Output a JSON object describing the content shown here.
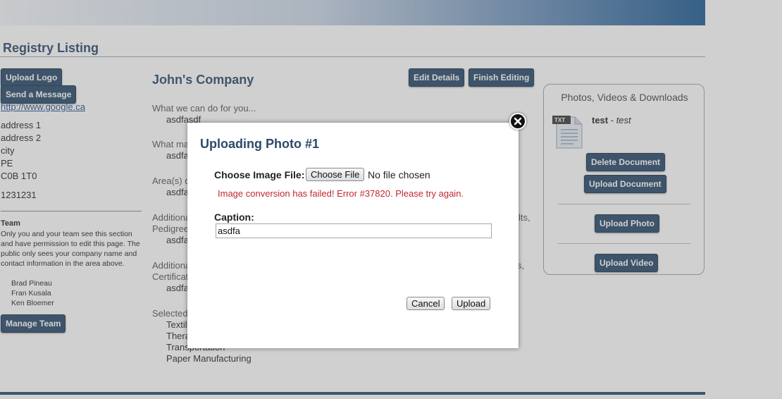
{
  "page": {
    "heading": "Registry Listing"
  },
  "left": {
    "upload_logo": "Upload Logo",
    "send_message": "Send a Message",
    "website": "http://www.google.ca",
    "address": [
      "address 1",
      "address 2",
      "city",
      "PE",
      "C0B 1T0"
    ],
    "phone": "1231231",
    "team_title": "Team",
    "team_desc": "Only you and your team see this section and have permission to edit this page. The public only sees your company name and contact information in the area above.",
    "members": [
      "Brad Pineau",
      "Fran Kusala",
      "Ken Bloemer"
    ],
    "manage_team": "Manage Team"
  },
  "main": {
    "company": "John's Company",
    "edit_details": "Edit Details",
    "finish_editing": "Finish Editing",
    "q1_label": "What we can do for you...",
    "q1_answer": "asdfasdf",
    "q2_label": "What ma",
    "q2_answer": "asdfa",
    "q3_label": "Area(s) o",
    "q3_answer": "asdfa",
    "q4_label": "Additiona",
    "q4_tail": "lts,",
    "q4_label2": "Pedigree",
    "q4_answer": "asdfa",
    "q5_label": "Additiona",
    "q5_tail": "s,",
    "q5_label2": "Certificat",
    "q5_answer": "asdfa",
    "selected_label": "Selected",
    "selected": [
      "Textil",
      "Thera",
      "Transportation",
      "Paper Manufacturing"
    ]
  },
  "side": {
    "title": "Photos, Videos & Downloads",
    "file_type": "TXT",
    "file_name": "test",
    "file_sep": " - ",
    "file_desc": "test",
    "delete_document": "Delete Document",
    "upload_document": "Upload Document",
    "upload_photo": "Upload Photo",
    "upload_video": "Upload Video"
  },
  "modal": {
    "title": "Uploading Photo #1",
    "choose_label": "Choose Image File:",
    "choose_button": "Choose File",
    "no_file": "No file chosen",
    "error": "Image conversion has failed! Error #37820. Please try again.",
    "caption_label": "Caption:",
    "caption_value": "asdfa",
    "cancel": "Cancel",
    "upload": "Upload"
  },
  "colors": {
    "accent": "#27496b",
    "error": "#c0282e",
    "heading": "#2b4a6b"
  },
  "icons": {
    "close": "close-icon",
    "file": "txt-file-icon"
  }
}
